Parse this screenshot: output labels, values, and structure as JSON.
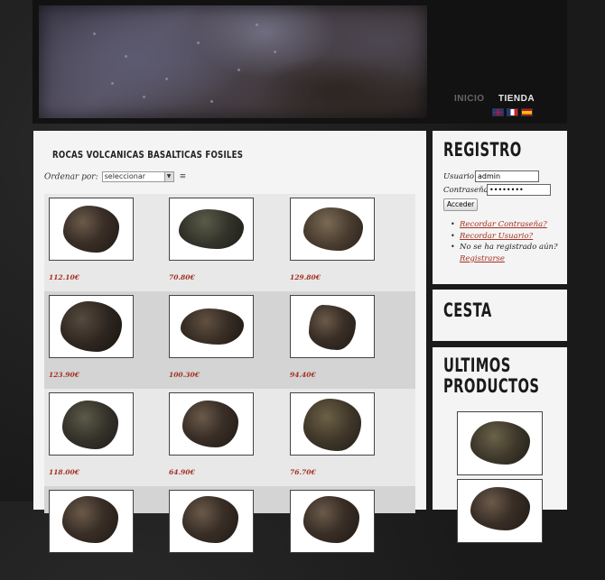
{
  "nav": {
    "items": [
      "INICIO",
      "TIENDA"
    ]
  },
  "languages": [
    "English",
    "Français",
    "Español"
  ],
  "category": {
    "title": "ROCAS VOLCANICAS BASALTICAS FOSILES"
  },
  "sort": {
    "label": "Ordenar por:",
    "selected": "seleccionar"
  },
  "products": [
    {
      "price": "112.10€"
    },
    {
      "price": "70.80€"
    },
    {
      "price": "129.80€"
    },
    {
      "price": "123.90€"
    },
    {
      "price": "100.30€"
    },
    {
      "price": "94.40€"
    },
    {
      "price": "118.00€"
    },
    {
      "price": "64.90€"
    },
    {
      "price": "76.70€"
    }
  ],
  "registro": {
    "title": "REGISTRO",
    "usuario_label": "Usuario",
    "usuario_value": "admin",
    "password_label": "Contraseña",
    "password_value": "••••••••",
    "login_label": "Acceder",
    "recordar_password": "Recordar Contraseña?",
    "recordar_usuario": "Recordar Usuario?",
    "no_registrado": "No se ha registrado aún?",
    "registrarse": "Registrarse"
  },
  "cesta": {
    "title": "CESTA"
  },
  "ultimos": {
    "title_line1": "ULTIMOS",
    "title_line2": "PRODUCTOS"
  },
  "colors": {
    "price": "#a33020",
    "link": "#a33020",
    "panel": "#f4f4f4",
    "page_bg": "#1c1c1c"
  }
}
